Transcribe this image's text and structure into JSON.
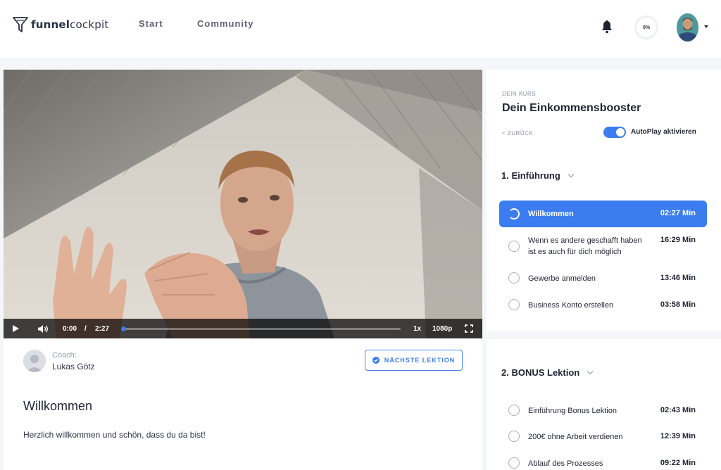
{
  "brand": {
    "name_bold": "funnel",
    "name_regular": "cockpit"
  },
  "nav": {
    "items": [
      {
        "label": "Start"
      },
      {
        "label": "Community"
      }
    ]
  },
  "header": {
    "progress_label": "0%"
  },
  "video": {
    "current_time": "0:00",
    "separator": "/",
    "duration": "2:27",
    "speed": "1x",
    "quality": "1080p",
    "progress_fraction": 0
  },
  "coach": {
    "label": "Coach:",
    "name": "Lukas Götz"
  },
  "next_button": {
    "label": "NÄCHSTE LEKTION"
  },
  "lesson": {
    "title": "Willkommen",
    "description": "Herzlich willkommen und schön, dass du da bist!"
  },
  "sidebar": {
    "kicker": "DEIN KURS",
    "course_title": "Dein Einkommensbooster",
    "back_label": "< ZURÜCK",
    "autoplay_label": "AutoPlay aktivieren",
    "autoplay_on": true,
    "sections": [
      {
        "title": "1. Einführung",
        "lessons": [
          {
            "name": "Willkommen",
            "duration": "02:27 Min",
            "active": true
          },
          {
            "name_line1": "Wenn es andere geschafft haben",
            "name_line2": "ist es auch für dich möglich",
            "duration": "16:29 Min"
          },
          {
            "name": "Gewerbe anmelden",
            "duration": "13:46 Min"
          },
          {
            "name": "Business Konto erstellen",
            "duration": "03:58 Min"
          }
        ]
      },
      {
        "title": "2. BONUS Lektion",
        "lessons": [
          {
            "name": "Einführung Bonus Lektion",
            "duration": "02:43 Min"
          },
          {
            "name": "200€ ohne Arbeit verdienen",
            "duration": "12:39 Min"
          },
          {
            "name": "Ablauf des Prozesses",
            "duration": "09:22 Min"
          }
        ]
      }
    ]
  },
  "colors": {
    "accent": "#3b7cf0",
    "text": "#1f2433",
    "muted": "#8c92a0",
    "background": "#f5f6fa"
  }
}
